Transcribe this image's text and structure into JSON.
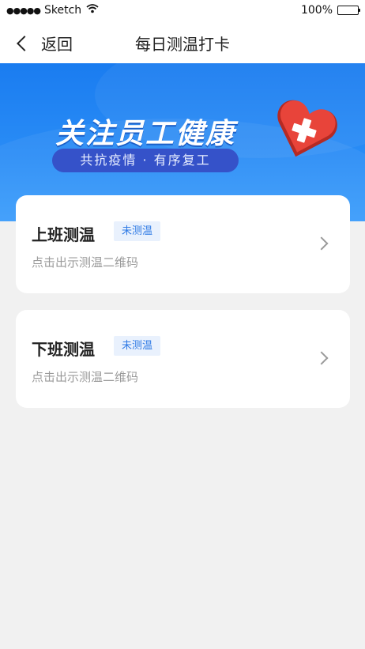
{
  "status_bar": {
    "signal_dots": "●●●●●",
    "carrier": "Sketch",
    "battery": "100%"
  },
  "nav": {
    "back_label": "返回",
    "title": "每日测温打卡"
  },
  "banner": {
    "headline": "关注员工健康",
    "slogan": "共抗疫情 · 有序复工"
  },
  "cards": [
    {
      "title": "上班测温",
      "badge": "未测温",
      "subtitle": "点击出示测温二维码"
    },
    {
      "title": "下班测温",
      "badge": "未测温",
      "subtitle": "点击出示测温二维码"
    }
  ],
  "colors": {
    "banner": "#1a7cf0",
    "badge_text": "#2f7ae5",
    "badge_bg": "#e9f1fd",
    "heart": "#e8443a"
  }
}
